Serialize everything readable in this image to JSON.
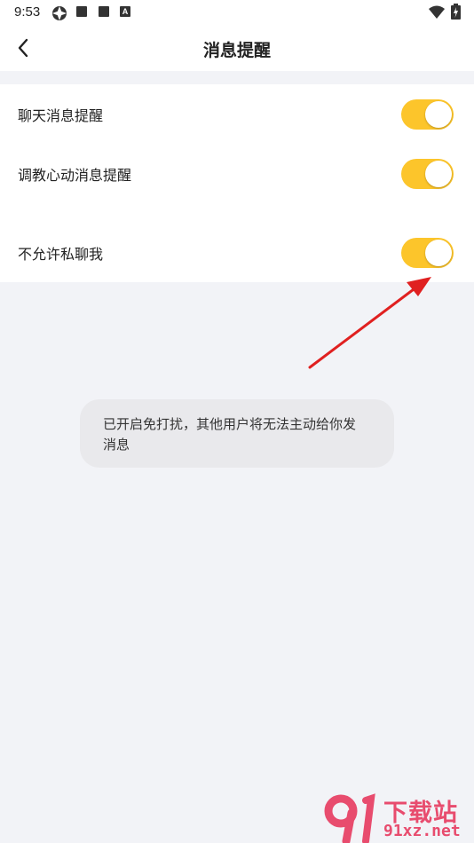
{
  "status_bar": {
    "time": "9:53",
    "icons": [
      "aperture-icon",
      "square-icon",
      "square-icon",
      "a-badge-icon",
      "wifi-icon",
      "battery-charging-icon"
    ]
  },
  "header": {
    "back_icon": "chevron-left-icon",
    "title": "消息提醒"
  },
  "settings": {
    "items": [
      {
        "label": "聊天消息提醒",
        "enabled": true
      },
      {
        "label": "调教心动消息提醒",
        "enabled": true
      },
      {
        "label": "不允许私聊我",
        "enabled": true
      }
    ]
  },
  "toast": {
    "line1": "已开启免打扰，其他用户将无法主动给你发",
    "line2": "消息"
  },
  "colors": {
    "toggle_on": "#fcc52b",
    "page_bg": "#f2f3f7",
    "arrow": "#e02020"
  },
  "watermark": {
    "text": "下载站",
    "domain": "91xz.net"
  }
}
